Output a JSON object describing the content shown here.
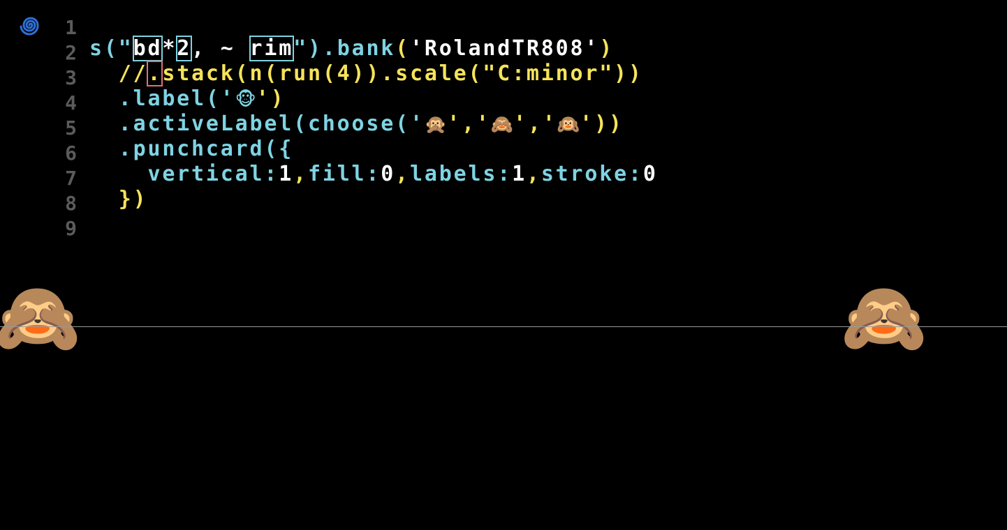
{
  "app": {
    "logo_icon": "spiral-icon"
  },
  "colors": {
    "background": "#000000",
    "keyword": "#7fd3e2",
    "string": "#ffffff",
    "comment": "#f5e35a",
    "highlight": "#7fd3e2",
    "playhead": "#9a9a9a"
  },
  "gutter": {
    "line_numbers": [
      "1",
      "2",
      "3",
      "4",
      "5",
      "6",
      "7",
      "8",
      "9"
    ]
  },
  "code": {
    "line1": {
      "t1": "s(\"",
      "t2": "bd",
      "t3": "*",
      "t4": "2",
      "t5": ", ~ ",
      "t6": "rim",
      "t7": "\").",
      "t8": "bank",
      "t9": "(",
      "t10": "'RolandTR808'",
      "t11": ")"
    },
    "line2": {
      "t1": "//",
      "t2": ".",
      "t3": "stack(n(run(4)).scale(\"C:minor\"))"
    },
    "line3": {
      "t1": ".label('",
      "emoji1": "🐵",
      "t2": "')"
    },
    "line4": {
      "t1": ".activeLabel(choose('",
      "emoji1": "🙊",
      "t2": "','",
      "emoji2": "🙈",
      "t3": "','",
      "emoji3": "🙉",
      "t4": "'))"
    },
    "line5": {
      "t1": ".punchcard({"
    },
    "line6": {
      "k1": "vertical:",
      "v1": "1",
      "s1": ",",
      "k2": "fill:",
      "v2": "0",
      "s2": ",",
      "k3": "labels:",
      "v3": "1",
      "s3": ",",
      "k4": "stroke:",
      "v4": "0"
    },
    "line7": {
      "t1": "})"
    }
  },
  "visual": {
    "left_column": [
      "🐵",
      "🐵",
      "🐵",
      "🐵",
      "🙈",
      "🐵",
      "🐵"
    ],
    "right_column": [
      "🐵",
      "🐵",
      "🙈",
      "🐵"
    ]
  }
}
